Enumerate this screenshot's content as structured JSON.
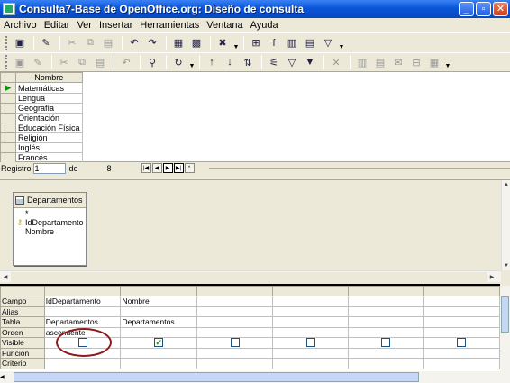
{
  "window": {
    "title": "Consulta7-Base de OpenOffice.org: Diseño de consulta",
    "buttons": [
      "_",
      "▫",
      "✕"
    ]
  },
  "menu": [
    "Archivo",
    "Editar",
    "Ver",
    "Insertar",
    "Herramientas",
    "Ventana",
    "Ayuda"
  ],
  "grid": {
    "column_header": "Nombre",
    "rows": [
      "Matemáticas",
      "Lengua",
      "Geografía",
      "Orientación",
      "Educación Física",
      "Religión",
      "Inglés",
      "Francés"
    ]
  },
  "record_nav": {
    "label": "Registro",
    "current": "1",
    "of": "de",
    "total": "8"
  },
  "table_window": {
    "title": "Departamentos",
    "fields": [
      "*",
      "IdDepartamento",
      "Nombre"
    ]
  },
  "design": {
    "row_labels": [
      "Campo",
      "Alias",
      "Tabla",
      "Orden",
      "Visible",
      "Función",
      "Criterio"
    ],
    "columns": [
      {
        "campo": "IdDepartamento",
        "alias": "",
        "tabla": "Departamentos",
        "orden": "ascendente",
        "visible": false
      },
      {
        "campo": "Nombre",
        "alias": "",
        "tabla": "Departamentos",
        "orden": "",
        "visible": true
      },
      {
        "campo": "",
        "alias": "",
        "tabla": "",
        "orden": "",
        "visible": false
      },
      {
        "campo": "",
        "alias": "",
        "tabla": "",
        "orden": "",
        "visible": false
      },
      {
        "campo": "",
        "alias": "",
        "tabla": "",
        "orden": "",
        "visible": false
      },
      {
        "campo": "",
        "alias": "",
        "tabla": "",
        "orden": "",
        "visible": false
      }
    ]
  },
  "colors": {
    "titlebar": "#0a55d8",
    "highlight_ellipse": "#8b1a1a",
    "checkmark": "#21a121"
  }
}
